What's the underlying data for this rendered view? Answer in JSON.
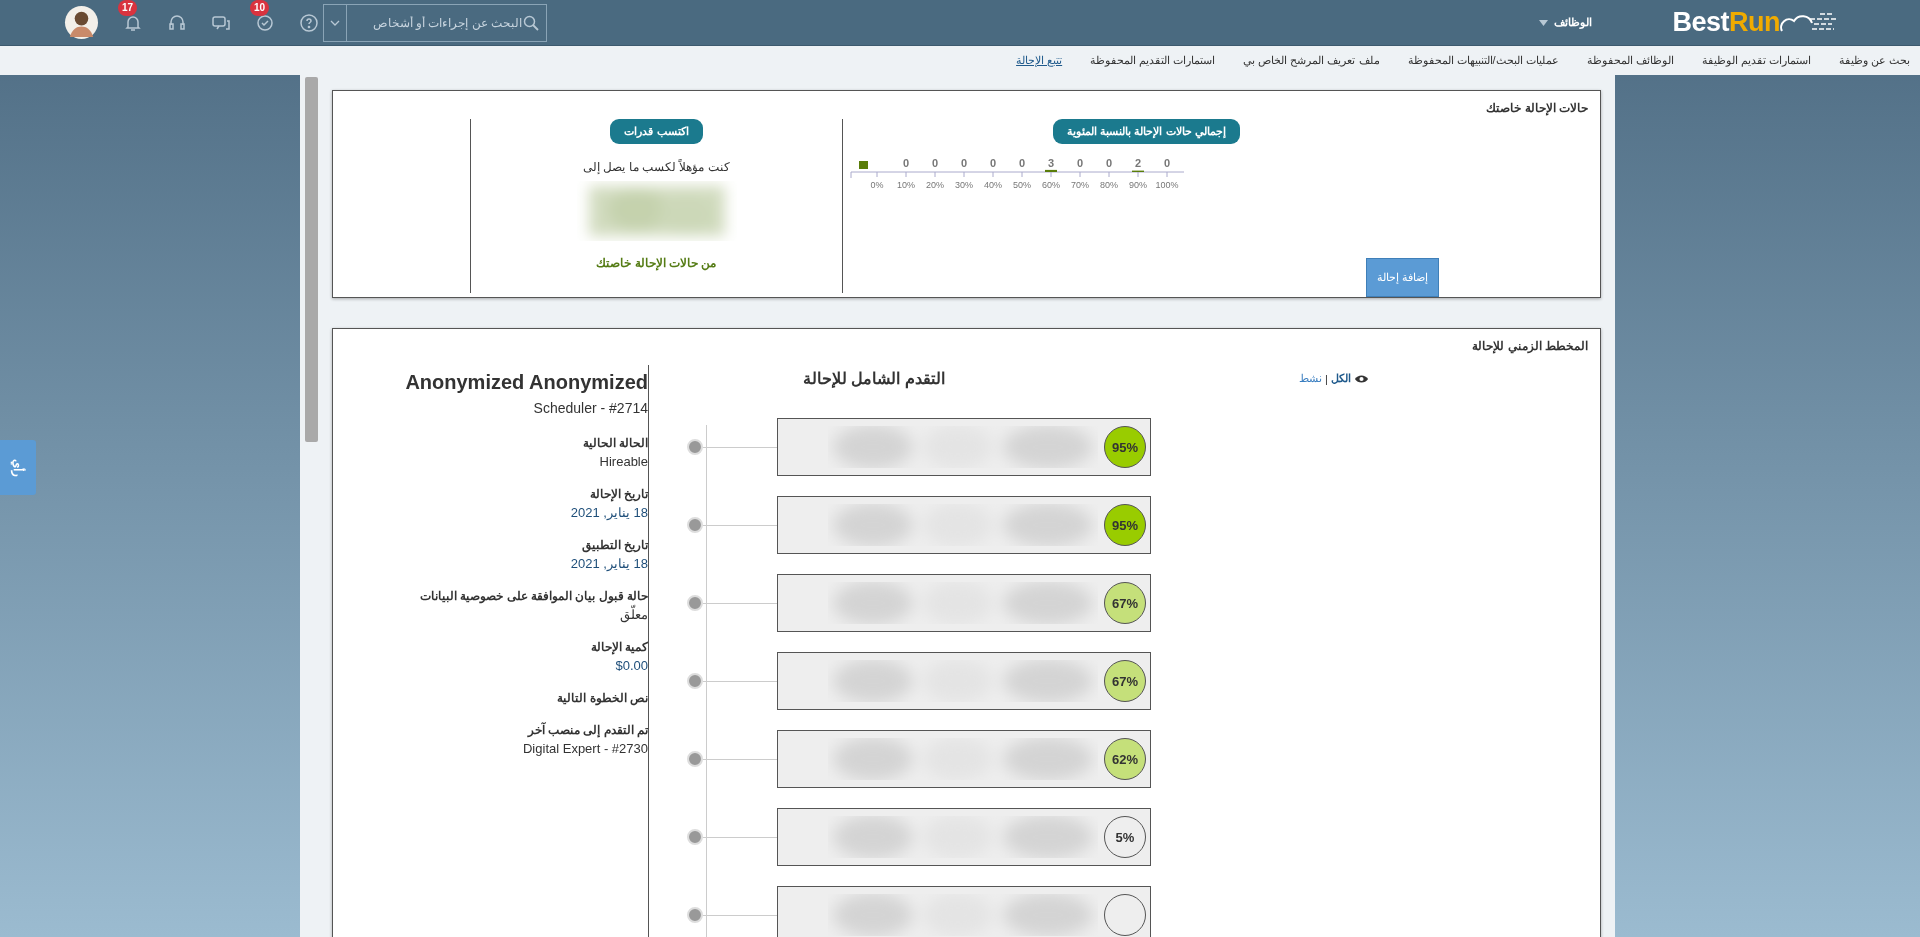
{
  "top_bar": {
    "logo": {
      "part_1": "Best",
      "part_2": "Run"
    },
    "menu": {
      "label": "الوظائف"
    },
    "search": {
      "placeholder": "البحث عن إجراءات أو أشخاص"
    },
    "badges": {
      "notifications": "17",
      "tasks": "10"
    }
  },
  "nav": [
    {
      "label": "بحث عن وظيفة",
      "selected": false
    },
    {
      "label": "استمارات تقديم الوظيفة",
      "selected": false
    },
    {
      "label": "الوظائف المحفوظة",
      "selected": false
    },
    {
      "label": "عمليات البحث/التنبيهات المحفوظة",
      "selected": false
    },
    {
      "label": "ملف تعريف المرشح الخاص بي",
      "selected": false
    },
    {
      "label": "استمارات التقديم المحفوظة",
      "selected": false
    },
    {
      "label": "تتبع الإحالة",
      "selected": true
    }
  ],
  "side_tab": {
    "label": "رأي"
  },
  "status_card": {
    "title": "حالات الإحالة خاصتك",
    "chart_section": {
      "heading": "إجمالي حالات الإحالة بالنسبة المئوية",
      "distribution": [
        {
          "range": "100%",
          "count": "0"
        },
        {
          "range": "90%",
          "count": "2"
        },
        {
          "range": "80%",
          "count": "0"
        },
        {
          "range": "70%",
          "count": "0"
        },
        {
          "range": "60%",
          "count": "3"
        },
        {
          "range": "50%",
          "count": "0"
        },
        {
          "range": "40%",
          "count": "0"
        },
        {
          "range": "30%",
          "count": "0"
        },
        {
          "range": "20%",
          "count": "0"
        },
        {
          "range": "10%",
          "count": "0"
        },
        {
          "range": "0%"
        }
      ],
      "button": "إضافة إحالة"
    },
    "earn_section": {
      "heading": "اكتسب قدرات",
      "text": "كنت مؤهلاً لكسب ما يصل إلى",
      "footer": "من حالات الإحالة خاصتك"
    }
  },
  "timeline_card": {
    "title": "المخطط الزمني للإحالة",
    "candidate": {
      "name": "Anonymized Anonymized",
      "position": "Scheduler - #2714"
    },
    "fields": [
      {
        "label": "الحالة الحالية",
        "value": "Hireable"
      },
      {
        "label": "تاريخ الإحالة",
        "value": "18 يناير, 2021"
      },
      {
        "label": "تاريخ التطبيق",
        "value": "18 يناير, 2021"
      },
      {
        "label": "حالة قبول بيان الموافقة على خصوصية البيانات",
        "value": "معلّق"
      },
      {
        "label": "كمية الإحالة",
        "value": "$0.00"
      },
      {
        "label": "نص الخطوة التالية"
      },
      {
        "label": "تم التقدم إلى منصب آخر",
        "value": "Digital Expert - #2730"
      }
    ],
    "progress_heading": "التقدم الشامل للإحالة",
    "filter": {
      "all": "الكل",
      "separator": "|",
      "active": "نشط"
    },
    "items": [
      {
        "percent": "95%",
        "color": "#99cc00"
      },
      {
        "percent": "95%",
        "color": "#99cc00"
      },
      {
        "percent": "67%",
        "color": "#c5e07a"
      },
      {
        "percent": "67%",
        "color": "#c5e07a"
      },
      {
        "percent": "62%",
        "color": "#c5e07a"
      },
      {
        "percent": "5%",
        "color": "#eeeeee"
      },
      {
        "color": "#eeeeee"
      }
    ]
  }
}
